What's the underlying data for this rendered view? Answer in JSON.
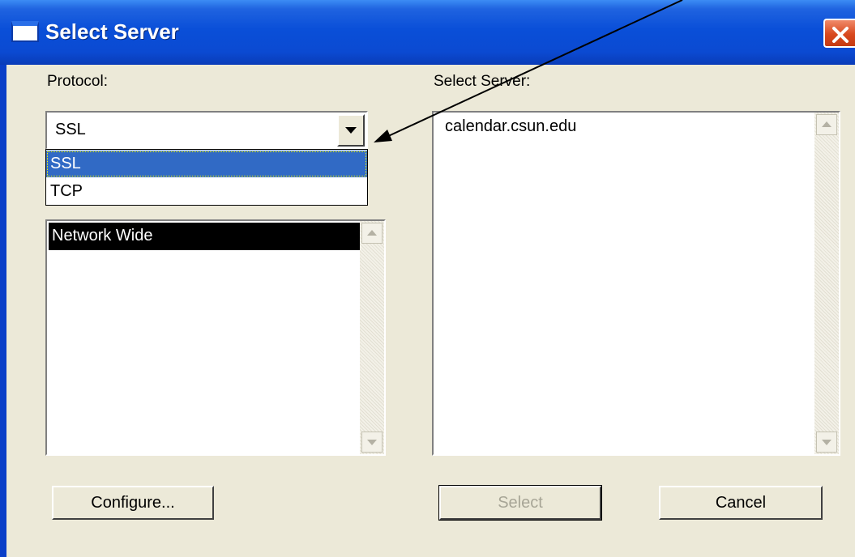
{
  "window": {
    "title": "Select Server"
  },
  "protocol": {
    "label": "Protocol:",
    "selected": "SSL",
    "options": [
      "SSL",
      "TCP"
    ],
    "highlighted": "SSL"
  },
  "scope_list": {
    "items": [
      "Network Wide"
    ]
  },
  "servers": {
    "label": "Select Server:",
    "items": [
      "calendar.csun.edu"
    ]
  },
  "buttons": {
    "configure": "Configure...",
    "select": "Select",
    "cancel": "Cancel"
  },
  "colors": {
    "titlebar": "#0a4fd8",
    "dialog_bg": "#ece9d8",
    "selection": "#316ac5",
    "close_button": "#d8481e"
  },
  "icons": [
    "window-icon",
    "close-icon",
    "dropdown-arrow-icon",
    "scroll-up-icon",
    "scroll-down-icon",
    "annotation-arrow"
  ]
}
